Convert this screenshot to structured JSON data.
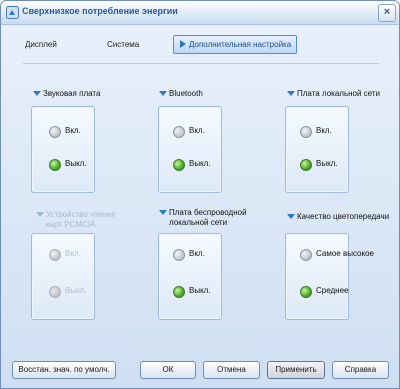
{
  "window": {
    "title": "Сверхнизкое потребление энергии",
    "close_label": "×"
  },
  "tabs": [
    {
      "label": "Дисплей"
    },
    {
      "label": "Система"
    },
    {
      "label": "Дополнительная настройка"
    }
  ],
  "groups": [
    {
      "title": "Звуковая плата",
      "options": [
        "Вкл.",
        "Выкл."
      ],
      "selected": 1,
      "enabled": true
    },
    {
      "title": "Bluetooth",
      "options": [
        "Вкл.",
        "Выкл."
      ],
      "selected": 1,
      "enabled": true
    },
    {
      "title": "Плата локальной сети",
      "options": [
        "Вкл.",
        "Выкл."
      ],
      "selected": 1,
      "enabled": true
    },
    {
      "title": "Устройство чтения карт PCMCIA",
      "title_line2": "",
      "options": [
        "Вкл.",
        "Выкл."
      ],
      "selected": 1,
      "enabled": false
    },
    {
      "title": "Плата беспроводной",
      "title_line2": "локальной сети",
      "options": [
        "Вкл.",
        "Выкл."
      ],
      "selected": 1,
      "enabled": true
    },
    {
      "title": "Качество цветопередачи",
      "options": [
        "Самое высокое",
        "Среднее"
      ],
      "selected": 1,
      "enabled": true
    }
  ],
  "buttons": {
    "restore": "Восстан. знач. по умолч.",
    "ok": "ОК",
    "cancel": "Отмена",
    "apply": "Применить",
    "help": "Справка"
  },
  "colors": {
    "accent": "#2f77c7",
    "selected_radio": "#4ea923",
    "title_text": "#245aa4"
  }
}
